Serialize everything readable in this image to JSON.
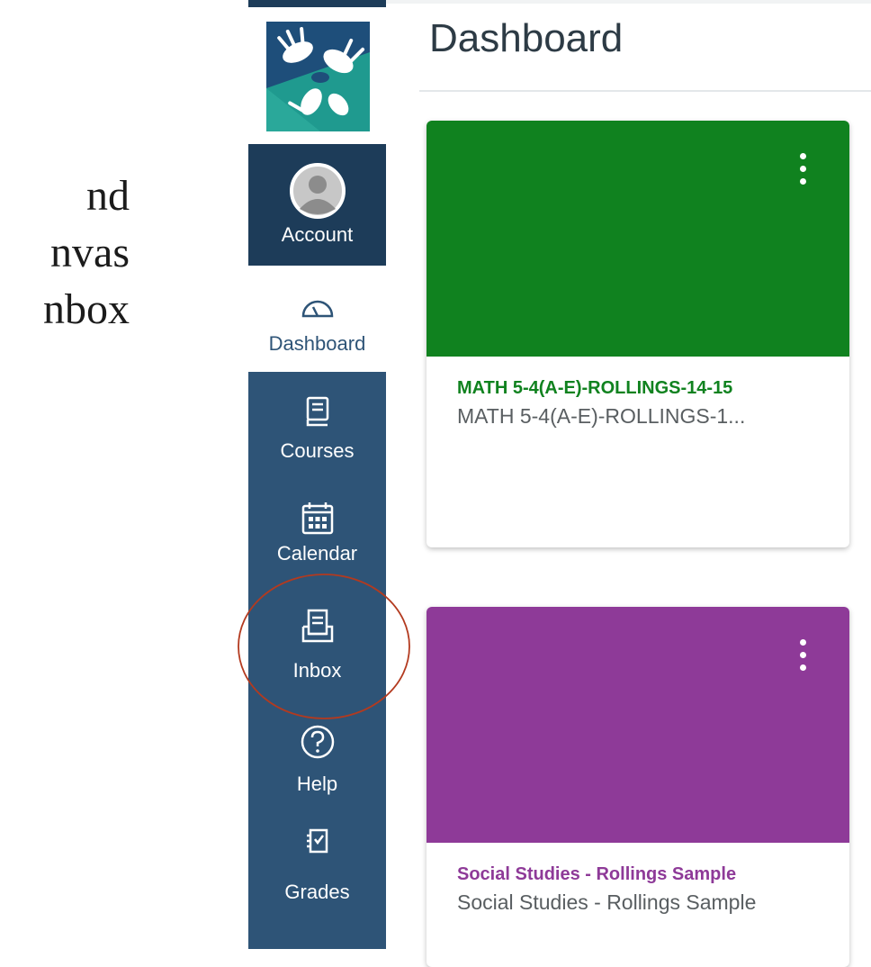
{
  "slide": {
    "lines": [
      "nd",
      "nvas",
      "nbox"
    ]
  },
  "sidebar": {
    "account_label": "Account",
    "dashboard_label": "Dashboard",
    "courses_label": "Courses",
    "calendar_label": "Calendar",
    "inbox_label": "Inbox",
    "help_label": "Help",
    "grades_label": "Grades",
    "colors": {
      "nav_bg": "#2e5477",
      "active_bg": "#ffffff"
    }
  },
  "header": {
    "title": "Dashboard"
  },
  "cards": [
    {
      "title": "MATH 5-4(A-E)-ROLLINGS-14-15",
      "subtitle": "MATH 5-4(A-E)-ROLLINGS-1...",
      "color": "#10821f"
    },
    {
      "title": "Social Studies - Rollings Sample",
      "subtitle": "Social Studies - Rollings Sample",
      "color": "#8e3a98"
    }
  ],
  "annotation": {
    "color": "#b33a1f"
  }
}
